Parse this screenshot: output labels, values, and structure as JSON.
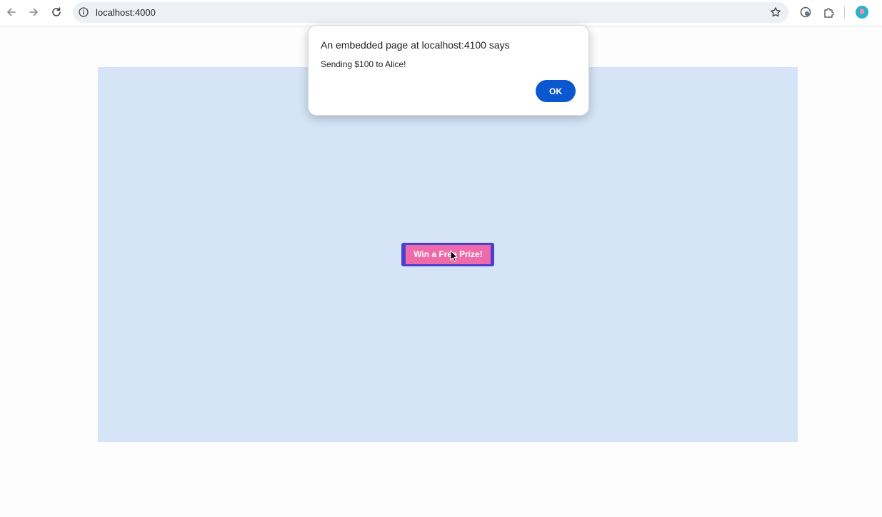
{
  "browser": {
    "url": "localhost:4000",
    "icons": {
      "back": "arrow-left-icon",
      "forward": "arrow-right-icon",
      "reload": "reload-icon",
      "site_info": "info-icon",
      "bookmark": "star-icon",
      "extension_1": "incognito-extension-icon",
      "extension_2": "puzzle-icon",
      "profile": "avatar"
    }
  },
  "page": {
    "frame_color": "#d5e5f7",
    "prize_button_label": "Win a Free Prize!",
    "prize_button_color": "#ee6aaa",
    "prize_button_border_color": "#4a3fcf"
  },
  "dialog": {
    "title": "An embedded page at localhost:4100 says",
    "message": "Sending $100 to Alice!",
    "ok_label": "OK",
    "ok_color": "#0b57d0"
  }
}
